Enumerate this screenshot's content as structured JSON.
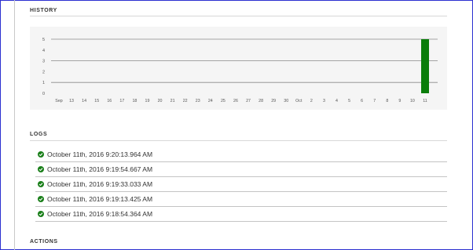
{
  "sections": {
    "history_title": "HISTORY",
    "logs_title": "LOGS",
    "actions_title": "ACTIONS"
  },
  "chart_data": {
    "type": "bar",
    "categories": [
      "Sep",
      "13",
      "14",
      "15",
      "16",
      "17",
      "18",
      "19",
      "20",
      "21",
      "22",
      "23",
      "24",
      "25",
      "26",
      "27",
      "28",
      "29",
      "30",
      "Oct",
      "2",
      "3",
      "4",
      "5",
      "6",
      "7",
      "8",
      "9",
      "10",
      "11"
    ],
    "values": [
      0,
      0,
      0,
      0,
      0,
      0,
      0,
      0,
      0,
      0,
      0,
      0,
      0,
      0,
      0,
      0,
      0,
      0,
      0,
      0,
      0,
      0,
      0,
      0,
      0,
      0,
      0,
      0,
      0,
      5
    ],
    "y_ticks": [
      "0",
      "1",
      "2",
      "3",
      "4",
      "5"
    ],
    "ylim": [
      0,
      5
    ],
    "grid": "horizontal",
    "bar_color": "#0a7d0a"
  },
  "logs": [
    {
      "text": "October 11th, 2016 9:20:13.964 AM",
      "status": "success"
    },
    {
      "text": "October 11th, 2016 9:19:54.667 AM",
      "status": "success"
    },
    {
      "text": "October 11th, 2016 9:19:33.033 AM",
      "status": "success"
    },
    {
      "text": "October 11th, 2016 9:19:13.425 AM",
      "status": "success"
    },
    {
      "text": "October 11th, 2016 9:18:54.364 AM",
      "status": "success"
    }
  ],
  "icons": {
    "log_status": "check-circle-icon"
  },
  "colors": {
    "success": "#1a7f1a",
    "frame": "#2b2fd0"
  }
}
